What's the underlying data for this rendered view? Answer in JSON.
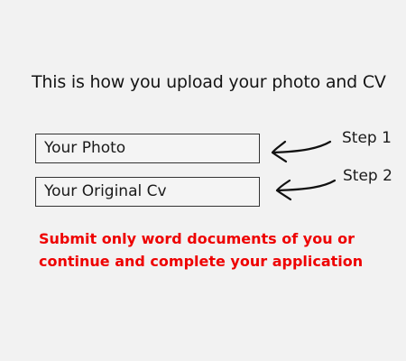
{
  "heading": "This is how you upload your photo and CV",
  "fields": {
    "photo_label": "Your Photo",
    "cv_label": "Your Original Cv"
  },
  "steps": {
    "step1": "Step 1",
    "step2": "Step 2"
  },
  "note": {
    "line1": "Submit only word documents of you or",
    "line2": "continue and complete your application"
  },
  "colors": {
    "background": "#f2f2f2",
    "note_text": "#ee0000",
    "field_border": "#333333"
  },
  "icons": [
    "hand-drawn-arrow-icon",
    "hand-drawn-arrow-icon"
  ]
}
